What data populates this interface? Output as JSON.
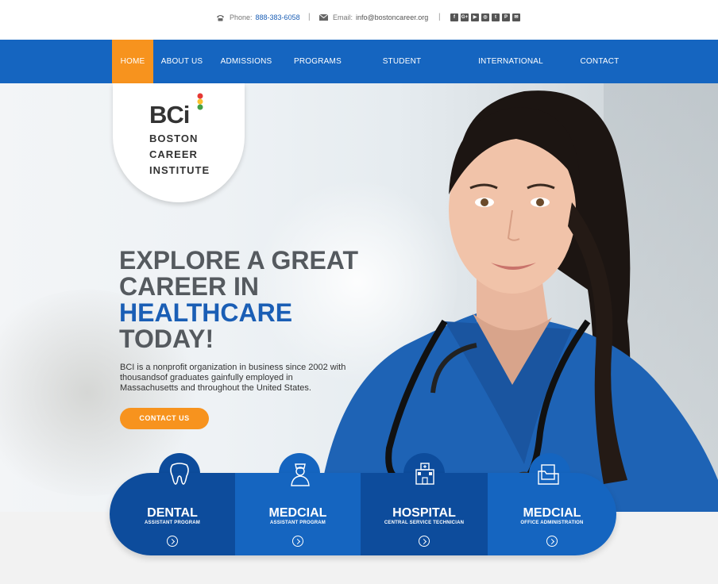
{
  "topbar": {
    "phone_label": "Phone:",
    "phone": "888-383-6058",
    "separator": "|",
    "email_label": "Email:",
    "email": "info@bostoncareer.org",
    "socials": [
      "f",
      "G+",
      "▶",
      "◎",
      "t",
      "P",
      "✉"
    ]
  },
  "nav": {
    "items": [
      "HOME",
      "ABOUT US",
      "ADMISSIONS",
      "PROGRAMS",
      "STUDENT SERVICES",
      "INTERNATIONAL STUDENTS",
      "CONTACT"
    ],
    "active": "HOME"
  },
  "logo": {
    "mark": "BCi",
    "line1": "BOSTON",
    "line2": "CAREER",
    "line3": "INSTITUTE"
  },
  "hero": {
    "line1": "EXPLORE A GREAT",
    "line2": "CAREER IN",
    "line3": "HEALTHCARE",
    "line4": "TODAY!",
    "description": "BCI is a nonprofit organization in business since 2002 with thousandsof graduates gainfully employed in Massachusetts and  throughout the United States.",
    "cta": "CONTACT US"
  },
  "programs": [
    {
      "title": "DENTAL",
      "subtitle": "ASSISTANT PROGRAM",
      "icon": "tooth-icon"
    },
    {
      "title": "MEDCIAL",
      "subtitle": "ASSISTANT PROGRAM",
      "icon": "nurse-icon"
    },
    {
      "title": "HOSPITAL",
      "subtitle": "CENTRAL SERVICE TECHNICIAN",
      "icon": "hospital-icon"
    },
    {
      "title": "MEDCIAL",
      "subtitle": "OFFICE ADMINISTRATION",
      "icon": "folder-icon"
    }
  ],
  "colors": {
    "brand_blue": "#1565c0",
    "accent_orange": "#f7931e",
    "dark_blue": "#0d4c9c"
  }
}
